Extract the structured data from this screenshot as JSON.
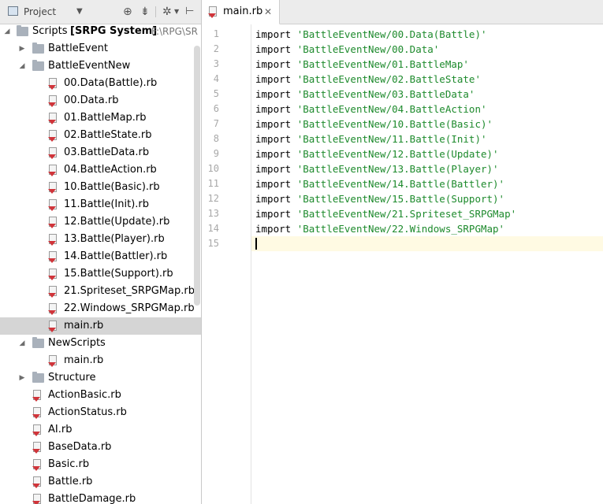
{
  "project_panel": {
    "title": "Project",
    "dropdown_arrow": "▼",
    "toolbar_icons": [
      "crosshair-icon",
      "collapse-all-icon",
      "gear-icon",
      "hide-panel-icon"
    ]
  },
  "tree": {
    "root": {
      "label": "Scripts",
      "tag": "[SRPG System]",
      "path": "F:\\RPG\\SR"
    },
    "battle_event": "BattleEvent",
    "battle_event_new": "BattleEventNew",
    "bev_files": [
      "00.Data(Battle).rb",
      "00.Data.rb",
      "01.BattleMap.rb",
      "02.BattleState.rb",
      "03.BattleData.rb",
      "04.BattleAction.rb",
      "10.Battle(Basic).rb",
      "11.Battle(Init).rb",
      "12.Battle(Update).rb",
      "13.Battle(Player).rb",
      "14.Battle(Battler).rb",
      "15.Battle(Support).rb",
      "21.Spriteset_SRPGMap.rb",
      "22.Windows_SRPGMap.rb",
      "main.rb"
    ],
    "new_scripts": "NewScripts",
    "new_scripts_files": [
      "main.rb"
    ],
    "structure": "Structure",
    "root_files": [
      "ActionBasic.rb",
      "ActionStatus.rb",
      "AI.rb",
      "BaseData.rb",
      "Basic.rb",
      "Battle.rb",
      "BattleDamage.rb"
    ]
  },
  "editor": {
    "tab_label": "main.rb",
    "tab_close": "✕",
    "line_numbers": [
      "1",
      "2",
      "3",
      "4",
      "5",
      "6",
      "7",
      "8",
      "9",
      "10",
      "11",
      "12",
      "13",
      "14",
      "15"
    ],
    "keyword": "import",
    "lines": [
      "'BattleEventNew/00.Data(Battle)'",
      "'BattleEventNew/00.Data'",
      "'BattleEventNew/01.BattleMap'",
      "'BattleEventNew/02.BattleState'",
      "'BattleEventNew/03.BattleData'",
      "'BattleEventNew/04.BattleAction'",
      "'BattleEventNew/10.Battle(Basic)'",
      "'BattleEventNew/11.Battle(Init)'",
      "'BattleEventNew/12.Battle(Update)'",
      "'BattleEventNew/13.Battle(Player)'",
      "'BattleEventNew/14.Battle(Battler)'",
      "'BattleEventNew/15.Battle(Support)'",
      "'BattleEventNew/21.Spriteset_SRPGMap'",
      "'BattleEventNew/22.Windows_SRPGMap'"
    ],
    "current_line": 15
  },
  "colors": {
    "string": "#1d8a2c",
    "selected_row": "#d5d5d5",
    "current_line": "#fffae3",
    "ruby_file_accent": "#d0343a"
  }
}
